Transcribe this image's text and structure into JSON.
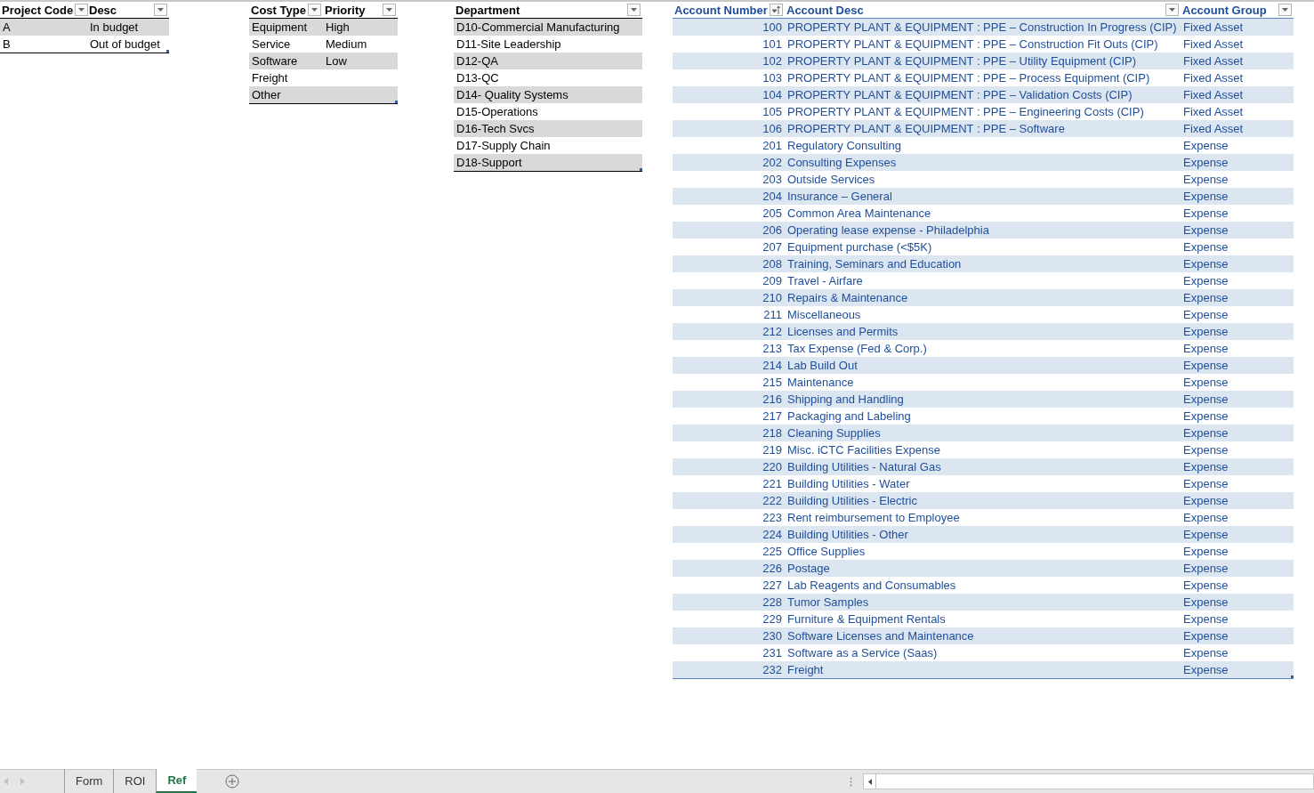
{
  "project_codes": {
    "columns": [
      {
        "label": "Project Code",
        "sorted": false
      },
      {
        "label": "Desc",
        "sorted": false
      }
    ],
    "rows": [
      [
        "A",
        "In budget"
      ],
      [
        "B",
        "Out of budget"
      ]
    ]
  },
  "cost_types": {
    "columns": [
      {
        "label": "Cost Type",
        "sorted": false
      },
      {
        "label": "Priority",
        "sorted": false
      }
    ],
    "rows": [
      [
        "Equipment",
        "High"
      ],
      [
        "Service",
        "Medium"
      ],
      [
        "Software",
        "Low"
      ],
      [
        "Freight",
        null
      ],
      [
        "Other",
        null
      ]
    ]
  },
  "departments": {
    "columns": [
      {
        "label": "Department",
        "sorted": false
      }
    ],
    "rows": [
      [
        "D10-Commercial Manufacturing"
      ],
      [
        "D11-Site Leadership"
      ],
      [
        "D12-QA"
      ],
      [
        "D13-QC"
      ],
      [
        "D14- Quality Systems"
      ],
      [
        "D15-Operations"
      ],
      [
        "D16-Tech Svcs"
      ],
      [
        "D17-Supply Chain"
      ],
      [
        "D18-Support"
      ]
    ]
  },
  "accounts": {
    "columns": [
      {
        "label": "Account Number",
        "sorted": true
      },
      {
        "label": "Account Desc",
        "sorted": false
      },
      {
        "label": "Account Group",
        "sorted": false
      }
    ],
    "rows": [
      [
        "100",
        "PROPERTY PLANT & EQUIPMENT : PPE – Construction In Progress (CIP)",
        "Fixed Asset"
      ],
      [
        "101",
        "PROPERTY PLANT & EQUIPMENT : PPE – Construction Fit Outs (CIP)",
        "Fixed Asset"
      ],
      [
        "102",
        "PROPERTY PLANT & EQUIPMENT : PPE – Utility Equipment (CIP)",
        "Fixed Asset"
      ],
      [
        "103",
        "PROPERTY PLANT & EQUIPMENT : PPE – Process Equipment (CIP)",
        "Fixed Asset"
      ],
      [
        "104",
        "PROPERTY PLANT & EQUIPMENT : PPE – Validation Costs (CIP)",
        "Fixed Asset"
      ],
      [
        "105",
        "PROPERTY PLANT & EQUIPMENT : PPE – Engineering Costs (CIP)",
        "Fixed Asset"
      ],
      [
        "106",
        "PROPERTY PLANT & EQUIPMENT : PPE – Software",
        "Fixed Asset"
      ],
      [
        "201",
        "Regulatory Consulting",
        "Expense"
      ],
      [
        "202",
        "Consulting Expenses",
        "Expense"
      ],
      [
        "203",
        "Outside Services",
        "Expense"
      ],
      [
        "204",
        "Insurance – General",
        "Expense"
      ],
      [
        "205",
        "Common Area Maintenance",
        "Expense"
      ],
      [
        "206",
        "Operating lease expense - Philadelphia",
        "Expense"
      ],
      [
        "207",
        "Equipment purchase (<$5K)",
        "Expense"
      ],
      [
        "208",
        "Training, Seminars and Education",
        "Expense"
      ],
      [
        "209",
        "Travel - Airfare",
        "Expense"
      ],
      [
        "210",
        "Repairs & Maintenance",
        "Expense"
      ],
      [
        "211",
        "Miscellaneous",
        "Expense"
      ],
      [
        "212",
        "Licenses and Permits",
        "Expense"
      ],
      [
        "213",
        "Tax Expense (Fed & Corp.)",
        "Expense"
      ],
      [
        "214",
        "Lab Build Out",
        "Expense"
      ],
      [
        "215",
        "Maintenance",
        "Expense"
      ],
      [
        "216",
        "Shipping and Handling",
        "Expense"
      ],
      [
        "217",
        "Packaging and Labeling",
        "Expense"
      ],
      [
        "218",
        "Cleaning Supplies",
        "Expense"
      ],
      [
        "219",
        "Misc. iCTC Facilities Expense",
        "Expense"
      ],
      [
        "220",
        "Building Utilities - Natural Gas",
        "Expense"
      ],
      [
        "221",
        "Building Utilities - Water",
        "Expense"
      ],
      [
        "222",
        "Building Utilities - Electric",
        "Expense"
      ],
      [
        "223",
        "Rent reimbursement to Employee",
        "Expense"
      ],
      [
        "224",
        "Building Utilities - Other",
        "Expense"
      ],
      [
        "225",
        "Office Supplies",
        "Expense"
      ],
      [
        "226",
        "Postage",
        "Expense"
      ],
      [
        "227",
        "Lab Reagents and Consumables",
        "Expense"
      ],
      [
        "228",
        "Tumor Samples",
        "Expense"
      ],
      [
        "229",
        "Furniture & Equipment Rentals",
        "Expense"
      ],
      [
        "230",
        "Software Licenses and Maintenance",
        "Expense"
      ],
      [
        "231",
        "Software as a Service (Saas)",
        "Expense"
      ],
      [
        "232",
        "Freight",
        "Expense"
      ]
    ]
  },
  "sheet_tabs": [
    {
      "label": "Form",
      "selected": false
    },
    {
      "label": "ROI",
      "selected": false
    },
    {
      "label": "Ref",
      "selected": true
    }
  ]
}
